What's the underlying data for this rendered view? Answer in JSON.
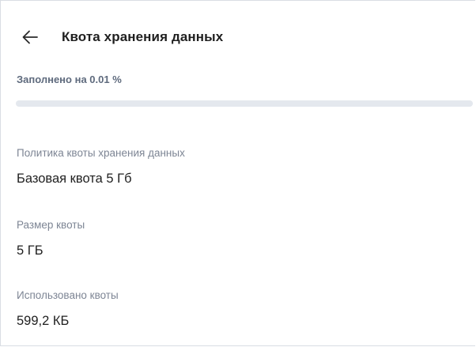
{
  "header": {
    "back_icon": "arrow-left-icon",
    "title": "Квота хранения данных"
  },
  "usage": {
    "label": "Заполнено на 0.01 %",
    "percent": 0.01,
    "track_color": "#e4e8ee",
    "fill_color": "#4a8de0"
  },
  "fields": [
    {
      "label": "Политика квоты хранения данных",
      "value": "Базовая квота 5 Гб"
    },
    {
      "label": "Размер квоты",
      "value": "5 ГБ"
    },
    {
      "label": "Использовано квоты",
      "value": "599,2 КБ"
    }
  ]
}
